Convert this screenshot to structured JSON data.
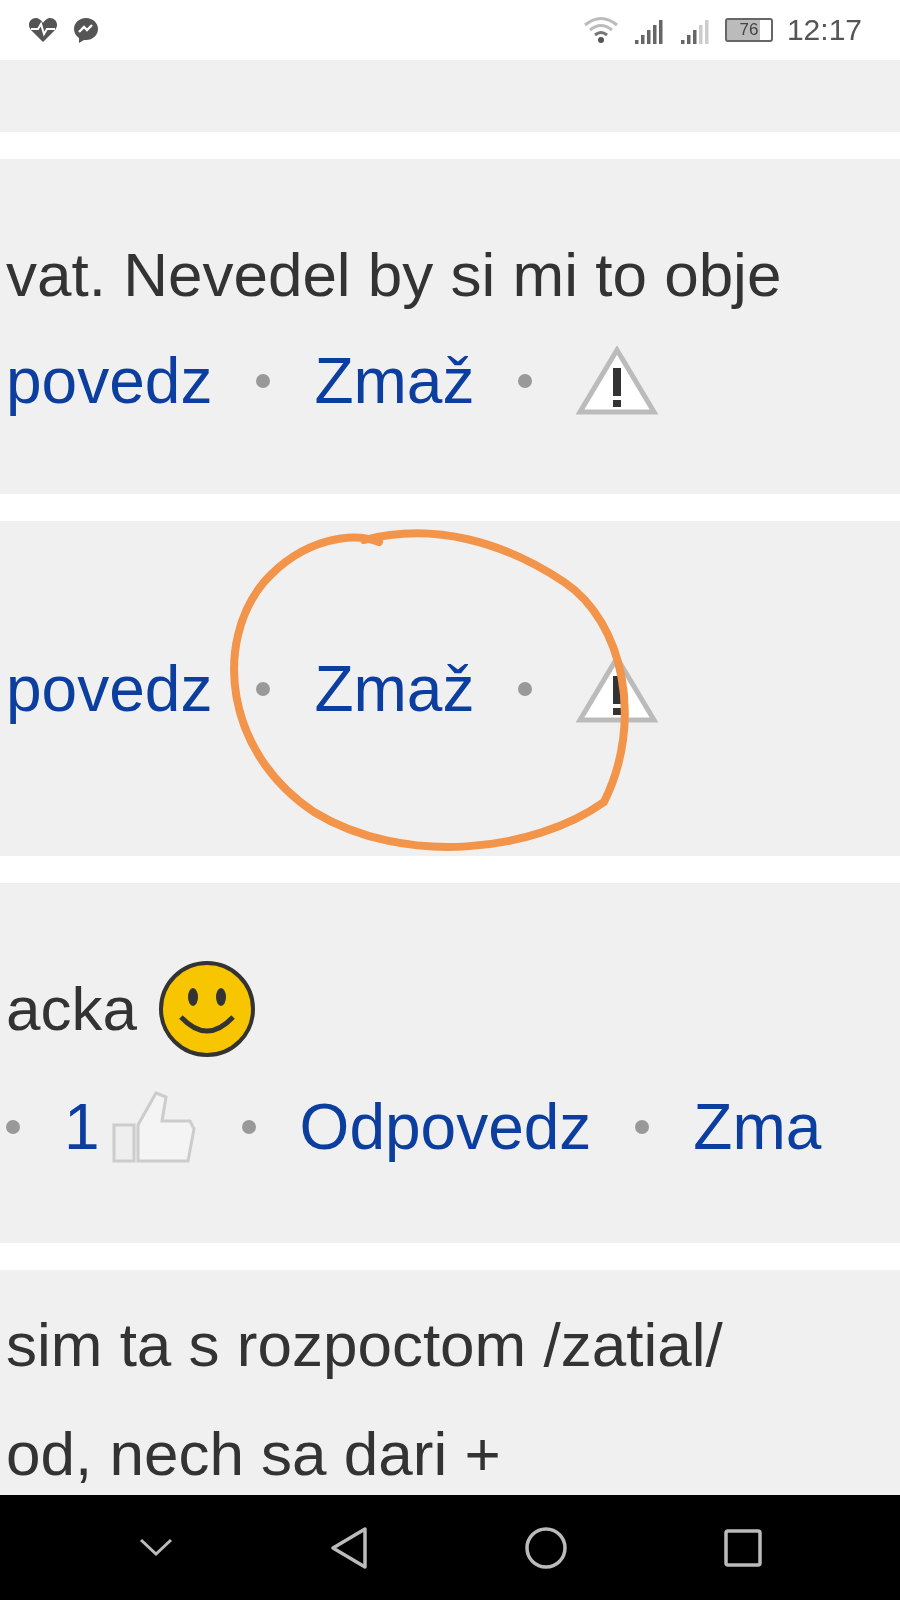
{
  "status_bar": {
    "battery": "76",
    "time": "12:17"
  },
  "comments": [
    {
      "lines": [
        "vat. Nevedel by si mi to obje"
      ],
      "actions": [
        {
          "kind": "link",
          "label": "povedz"
        },
        {
          "kind": "dot"
        },
        {
          "kind": "link",
          "label": "Zmaž"
        },
        {
          "kind": "dot"
        },
        {
          "kind": "report"
        }
      ]
    },
    {
      "actions": [
        {
          "kind": "link",
          "label": "povedz"
        },
        {
          "kind": "dot"
        },
        {
          "kind": "circled_link",
          "label": "Zmaž"
        },
        {
          "kind": "dot"
        },
        {
          "kind": "report"
        }
      ]
    },
    {
      "lines": [
        "acka"
      ],
      "trailing_icon": {
        "kind": "smiley"
      },
      "actions": [
        {
          "kind": "dot"
        },
        {
          "kind": "likes",
          "count": "1"
        },
        {
          "kind": "dot"
        },
        {
          "kind": "link",
          "label": "Odpovedz"
        },
        {
          "kind": "dot"
        },
        {
          "kind": "link",
          "label": "Zma"
        }
      ]
    },
    {
      "lines": [
        "sim ta s rozpoctom /zatial/",
        "od, nech sa dari +"
      ]
    }
  ]
}
